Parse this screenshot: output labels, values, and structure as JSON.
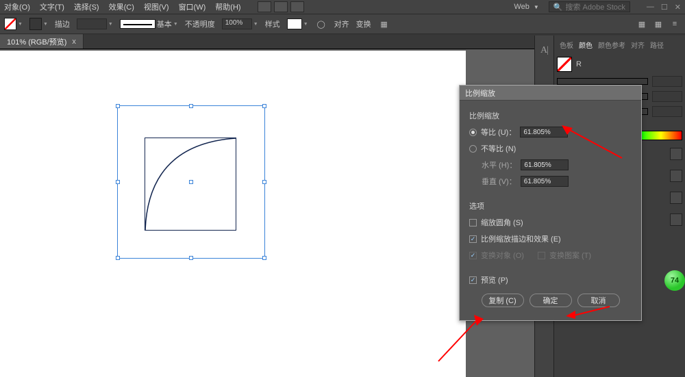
{
  "menu": {
    "object": "对象(O)",
    "text": "文字(T)",
    "select": "选择(S)",
    "effect": "效果(C)",
    "view": "视图(V)",
    "window": "窗口(W)",
    "help": "帮助(H)"
  },
  "profile": {
    "name": "Web",
    "search_placeholder": "搜索 Adobe Stock"
  },
  "ctrl": {
    "stroke_label": "描边",
    "stroke_preset": "基本",
    "opacity_label": "不透明度",
    "opacity_value": "100%",
    "style_label": "样式",
    "align_label": "对齐",
    "transform_label": "变换"
  },
  "tab": {
    "title": "101% (RGB/预览)",
    "close": "x"
  },
  "panel": {
    "tabs": {
      "swatches": "色板",
      "color": "颜色",
      "colorguide": "颜色参考",
      "align": "对齐",
      "pathfinder": "路径"
    },
    "r_label": "R"
  },
  "dialog": {
    "title": "比例缩放",
    "scale_group": "比例缩放",
    "uniform": "等比 (U)：",
    "nonuniform": "不等比 (N)",
    "horizontal": "水平 (H)：",
    "vertical": "垂直 (V)：",
    "uniform_value": "61.805%",
    "h_value": "61.805%",
    "v_value": "61.805%",
    "options_group": "选项",
    "scale_corners": "缩放圆角 (S)",
    "scale_strokes": "比例缩放描边和效果 (E)",
    "transform_objects": "变换对象 (O)",
    "transform_patterns": "变换图案 (T)",
    "preview": "预览 (P)",
    "btn_copy": "复制 (C)",
    "btn_ok": "确定",
    "btn_cancel": "取消"
  },
  "badge": {
    "value": "74"
  }
}
